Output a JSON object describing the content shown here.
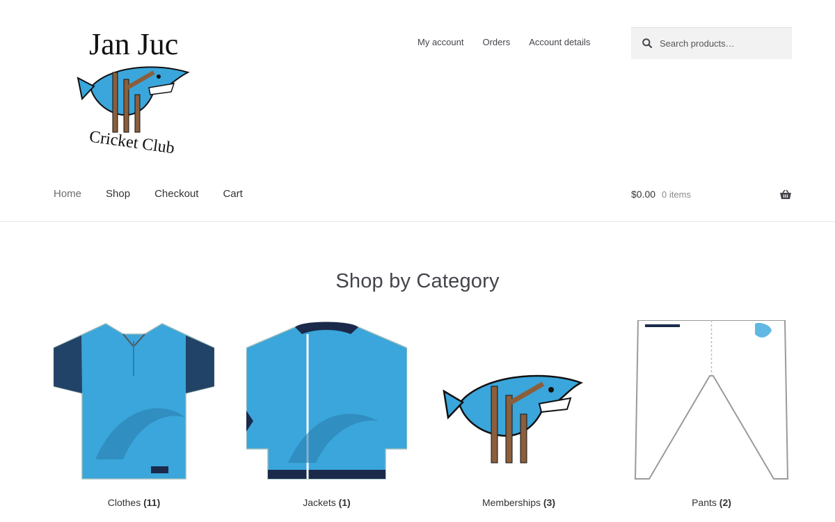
{
  "logo": {
    "line1": "Jan Juc",
    "line2": "Cricket Club",
    "colors": {
      "shark": "#3aa6db",
      "stumps": "#8b5e3c",
      "text": "#111111"
    }
  },
  "secondary_nav": [
    "My account",
    "Orders",
    "Account details"
  ],
  "search": {
    "placeholder": "Search products…",
    "icon": "search-icon"
  },
  "primary_nav": [
    "Home",
    "Shop",
    "Checkout",
    "Cart"
  ],
  "cart": {
    "amount": "$0.00",
    "items": "0 items",
    "icon": "basket-icon"
  },
  "section_title": "Shop by Category",
  "categories": [
    {
      "name": "Clothes",
      "count": "(11)"
    },
    {
      "name": "Jackets",
      "count": "(1)"
    },
    {
      "name": "Memberships",
      "count": "(3)"
    },
    {
      "name": "Pants",
      "count": "(2)"
    }
  ],
  "colors": {
    "accent": "#3aa6db",
    "navy": "#1b2a4a",
    "text": "#43454b"
  }
}
